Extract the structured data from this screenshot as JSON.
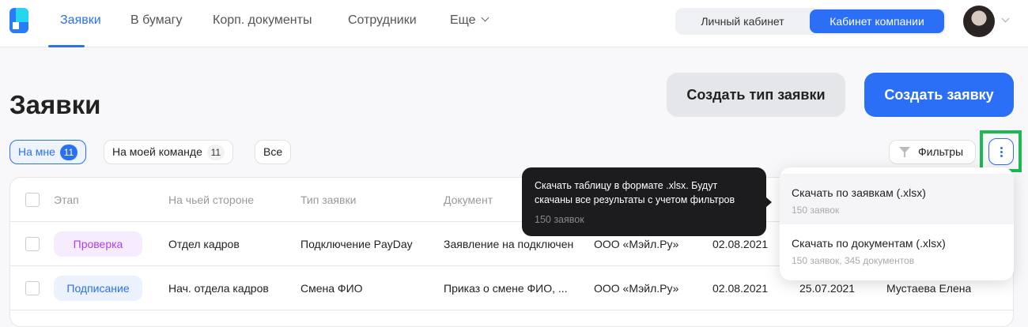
{
  "nav": {
    "items": [
      "Заявки",
      "В бумагу",
      "Корп. документы",
      "Сотрудники",
      "Еще"
    ],
    "switch": {
      "personal": "Личный кабинет",
      "company": "Кабинет компании"
    }
  },
  "page": {
    "title": "Заявки",
    "create_type": "Создать тип заявки",
    "create": "Создать заявку"
  },
  "chips": [
    {
      "label": "На мне",
      "count": "11"
    },
    {
      "label": "На моей команде",
      "count": "11"
    },
    {
      "label": "Все"
    }
  ],
  "filters": "Фильтры",
  "table": {
    "headers": [
      "Этап",
      "На чьей стороне",
      "Тип заявки",
      "Документ"
    ],
    "rows": [
      {
        "stage": "Проверка",
        "side": "Отдел кадров",
        "type": "Подключение PayDay",
        "doc": "Заявление на подключен",
        "company": "ООО «Мэйл.Ру»",
        "date1": "02.08.2021",
        "date2": "",
        "person": ""
      },
      {
        "stage": "Подписание",
        "side": "Нач. отдела кадров",
        "type": "Смена ФИО",
        "doc": "Приказ о смене ФИО, ...",
        "company": "ООО «Мэйл.Ру»",
        "date1": "02.08.2021",
        "date2": "25.07.2021",
        "person": "Мустаева Елена"
      }
    ]
  },
  "tooltip": {
    "text": "Скачать таблицу в формате .xlsx. Будут скачаны все результаты с учетом фильтров",
    "sub": "150 заявок"
  },
  "menu": [
    {
      "title": "Скачать по заявкам (.xlsx)",
      "sub": "150 заявок"
    },
    {
      "title": "Скачать по документам (.xlsx)",
      "sub": "150 заявок, 345 документов"
    }
  ],
  "colors": {
    "accent": "#2a6ff6",
    "check": "#a93ef0",
    "check_bg": "#f7ecfd",
    "sign_bg": "#ebf2fe",
    "highlight": "#1db954"
  }
}
